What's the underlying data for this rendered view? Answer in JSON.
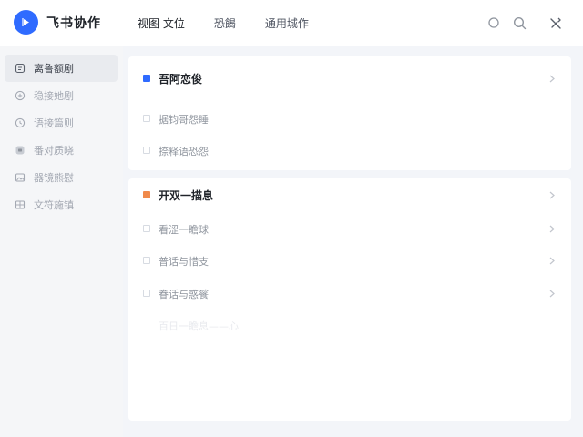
{
  "app": {
    "title": "飞书协作",
    "brand_color": "#2f6bff",
    "logo_icon": "play-icon"
  },
  "nav": {
    "items": [
      "视图 文位",
      "恐餲",
      "通用城作"
    ]
  },
  "header_icons": [
    "circle-icon",
    "search-icon",
    "settings-icon"
  ],
  "sidebar": {
    "items": [
      {
        "label": "离鲁额剧",
        "icon": "document-icon",
        "active": true
      },
      {
        "label": "稳接她剧",
        "icon": "plus-circle-icon",
        "active": false
      },
      {
        "label": "语接篇则",
        "icon": "clock-icon",
        "active": false
      },
      {
        "label": "番对质晓",
        "icon": "archive-icon",
        "active": false
      },
      {
        "label": "器镜熊慰",
        "icon": "image-icon",
        "active": false
      },
      {
        "label": "文符施镇",
        "icon": "grid-icon",
        "active": false
      }
    ]
  },
  "main": {
    "section1": {
      "title": "吾阿恋俊",
      "accent": "#2f6bff",
      "items": [
        "据钧哥怨睡",
        "捺释语恐怨"
      ]
    },
    "section2": {
      "title": "开双一描息",
      "accent": "#f08a4b",
      "items": [
        "看涩一瞻球",
        "普话与惜支",
        "眷话与惑餮"
      ],
      "faint_item": "百日一瞻息——心"
    }
  }
}
